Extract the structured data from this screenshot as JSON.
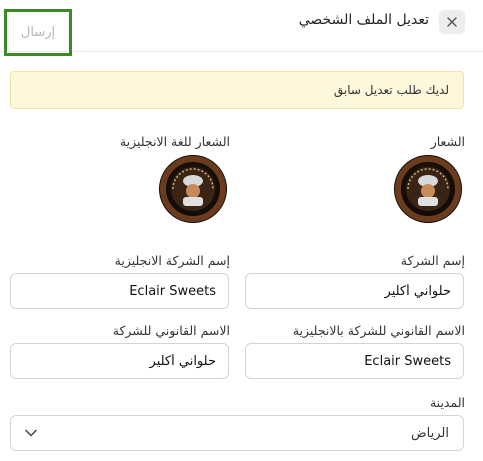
{
  "header": {
    "title": "تعديل الملف الشخصي",
    "submit_label": "إرسال"
  },
  "notice": {
    "text": "لديك طلب تعديل سابق"
  },
  "logos": {
    "logo_label": "الشعار",
    "logo_en_label": "الشعار للغة الانجليزية"
  },
  "company": {
    "name_label": "إسم الشركة",
    "name_value": "حلواني أكلير",
    "name_en_label": "إسم الشركة الانجليزية",
    "name_en_value": "Eclair Sweets"
  },
  "legal": {
    "name_en_label": "الاسم القانوني للشركة بالانجليزية",
    "name_en_value": "Eclair Sweets",
    "name_label": "الاسم القانوني للشركة",
    "name_value": "حلواني أكلير"
  },
  "city": {
    "label": "المدينة",
    "value": "الرياض"
  },
  "icons": {
    "close": "close-icon",
    "chevron": "chevron-down-icon",
    "logo": "bakery-logo"
  }
}
